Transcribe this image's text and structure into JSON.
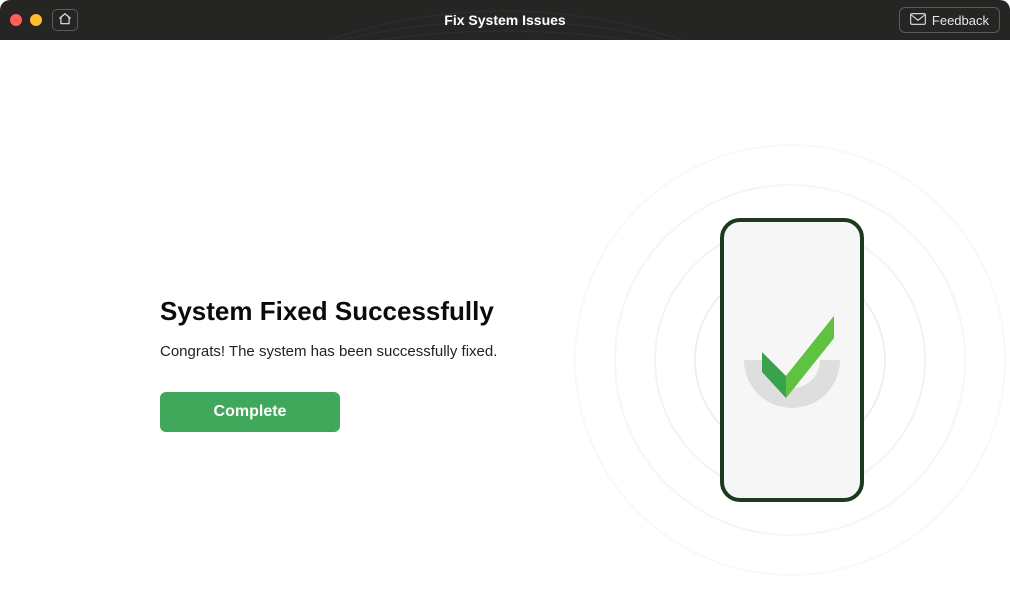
{
  "titlebar": {
    "title": "Fix System Issues",
    "feedback_label": "Feedback"
  },
  "main": {
    "heading": "System Fixed Successfully",
    "subtext": "Congrats! The system has been successfully fixed.",
    "complete_label": "Complete"
  },
  "colors": {
    "titlebar_bg": "#252524",
    "accent_green": "#40a85b",
    "check_green_dark": "#2a8a3f",
    "check_green_light": "#5fc341"
  }
}
